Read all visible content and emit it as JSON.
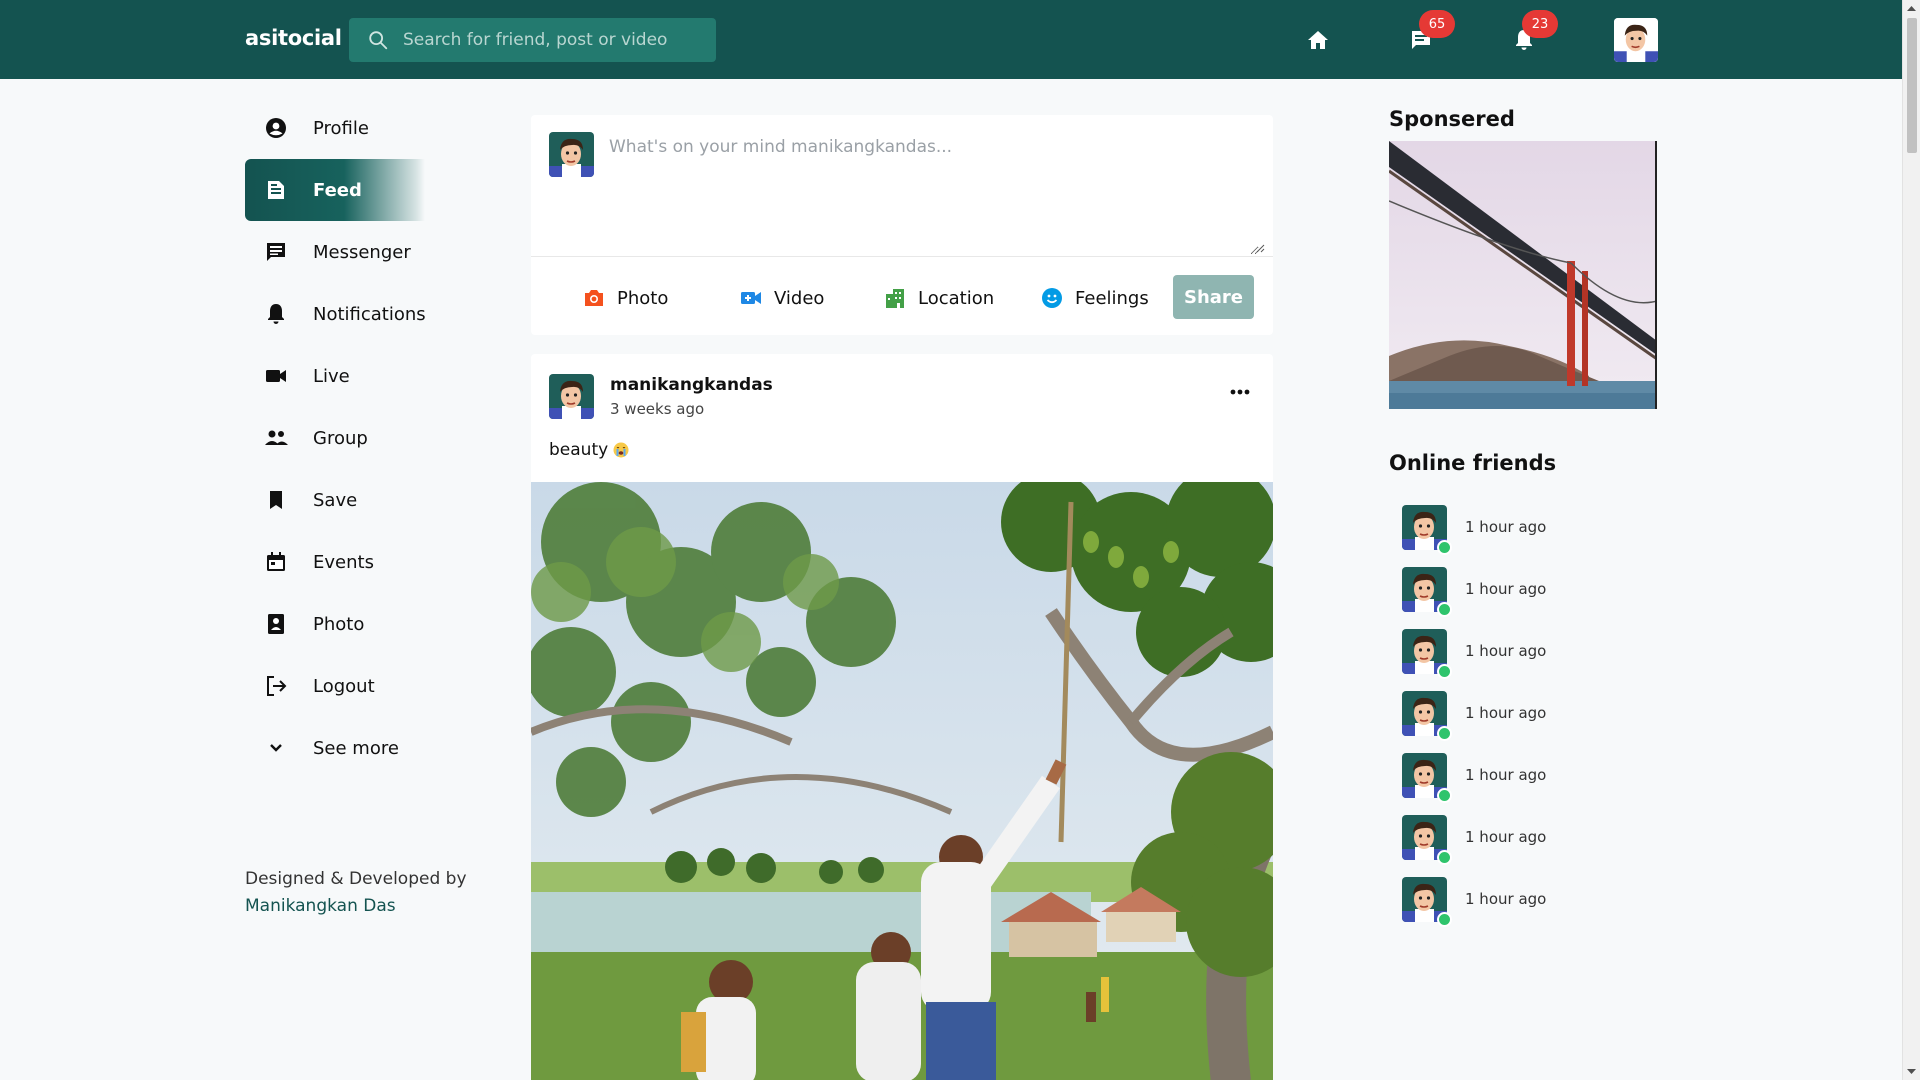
{
  "brand": "asitocial",
  "search": {
    "placeholder": "Search for friend, post or video"
  },
  "header": {
    "messages_count": "65",
    "notifications_count": "23"
  },
  "sidebar": {
    "items": [
      {
        "label": "Profile",
        "icon": "account-circle-icon"
      },
      {
        "label": "Feed",
        "icon": "feed-icon"
      },
      {
        "label": "Messenger",
        "icon": "chat-icon"
      },
      {
        "label": "Notifications",
        "icon": "bell-icon"
      },
      {
        "label": "Live",
        "icon": "video-camera-icon"
      },
      {
        "label": "Group",
        "icon": "group-icon"
      },
      {
        "label": "Save",
        "icon": "bookmark-icon"
      },
      {
        "label": "Events",
        "icon": "calendar-icon"
      },
      {
        "label": "Photo",
        "icon": "photo-icon"
      },
      {
        "label": "Logout",
        "icon": "logout-icon"
      },
      {
        "label": "See more",
        "icon": "chevron-down-icon"
      }
    ],
    "active": "Feed",
    "credit_text": "Designed & Developed by",
    "credit_author": "Manikangkan Das"
  },
  "composer": {
    "placeholder": "What's on your mind manikangkandas...",
    "actions": [
      {
        "label": "Photo",
        "icon": "camera-icon",
        "color": "#f4511e"
      },
      {
        "label": "Video",
        "icon": "video-add-icon",
        "color": "#1e88e5"
      },
      {
        "label": "Location",
        "icon": "location-building-icon",
        "color": "#43a047"
      },
      {
        "label": "Feelings",
        "icon": "smile-icon",
        "color": "#039be5"
      }
    ],
    "share_label": "Share"
  },
  "post": {
    "author": "manikangkandas",
    "time": "3 weeks ago",
    "caption": "beauty"
  },
  "right": {
    "sponsored_title": "Sponsered",
    "online_title": "Online friends",
    "friends": [
      {
        "time": "1 hour ago"
      },
      {
        "time": "1 hour ago"
      },
      {
        "time": "1 hour ago"
      },
      {
        "time": "1 hour ago"
      },
      {
        "time": "1 hour ago"
      },
      {
        "time": "1 hour ago"
      },
      {
        "time": "1 hour ago"
      }
    ]
  },
  "colors": {
    "primary": "#145350",
    "search_bg": "#237a6f",
    "badge": "#e53935",
    "online": "#2fc46c",
    "share_disabled": "#8fb5b1"
  }
}
